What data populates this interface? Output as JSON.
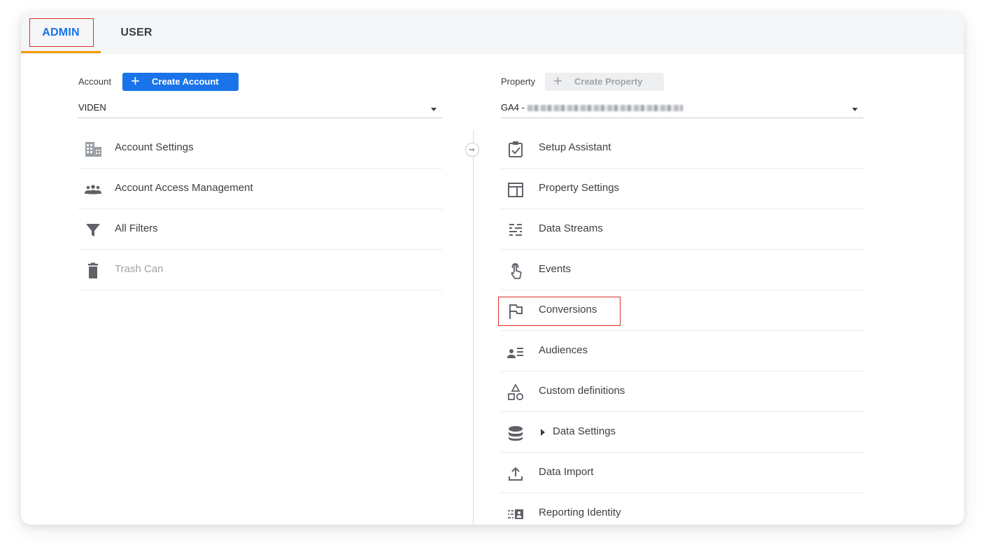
{
  "tabs": {
    "admin": "ADMIN",
    "user": "USER"
  },
  "account": {
    "label": "Account",
    "create_button": "Create Account",
    "selected": "VIDEN",
    "menu": [
      {
        "label": "Account Settings",
        "icon": "building-icon"
      },
      {
        "label": "Account Access Management",
        "icon": "people-icon"
      },
      {
        "label": "All Filters",
        "icon": "filter-icon"
      },
      {
        "label": "Trash Can",
        "icon": "trash-icon"
      }
    ]
  },
  "property": {
    "label": "Property",
    "create_button": "Create Property",
    "selected_prefix": "GA4 -",
    "menu": [
      {
        "label": "Setup Assistant",
        "icon": "checklist-icon"
      },
      {
        "label": "Property Settings",
        "icon": "layout-icon"
      },
      {
        "label": "Data Streams",
        "icon": "streams-icon"
      },
      {
        "label": "Events",
        "icon": "touch-icon"
      },
      {
        "label": "Conversions",
        "icon": "flag-icon"
      },
      {
        "label": "Audiences",
        "icon": "audience-icon"
      },
      {
        "label": "Custom definitions",
        "icon": "shapes-icon"
      },
      {
        "label": "Data Settings",
        "icon": "database-icon"
      },
      {
        "label": "Data Import",
        "icon": "upload-icon"
      },
      {
        "label": "Reporting Identity",
        "icon": "identity-icon"
      }
    ]
  },
  "colors": {
    "accent": "#1a73e8",
    "tab_underline": "#f29900",
    "highlight_box": "#d93025"
  }
}
